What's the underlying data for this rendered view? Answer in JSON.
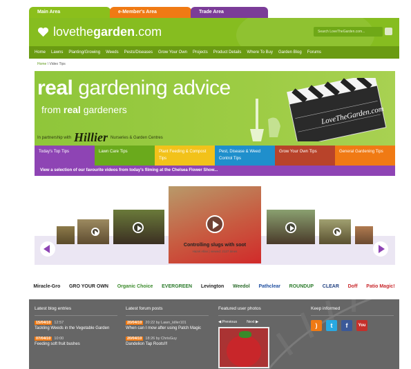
{
  "tabs": {
    "main": "Main Area",
    "member": "e-Member's Area",
    "trade": "Trade Area"
  },
  "logo": {
    "pre": "lovethe",
    "bold": "garden",
    "post": ".com"
  },
  "search": {
    "placeholder": "Search LoveTheGarden.com..."
  },
  "nav": [
    "Home",
    "Lawns",
    "Planting/Growing",
    "Weeds",
    "Pests/Diseases",
    "Grow Your Own",
    "Projects",
    "Product Details",
    "Where To Buy",
    "Garden Blog",
    "Forums"
  ],
  "breadcrumb": {
    "home": "Home",
    "sep": " \\ ",
    "current": "Video Tips"
  },
  "hero": {
    "line1_bold": "real",
    "line1_rest": " gardening advice",
    "line2_pre": "from ",
    "line2_bold": "real",
    "line2_post": " gardeners",
    "partner_pre": "In partnership with",
    "partner_brand": "Hillier",
    "partner_post": "Nurseries & Garden Centres",
    "clapper_text": "LoveTheGarden.com"
  },
  "tips": [
    {
      "label": "Today's Top Tips",
      "color": "#8e44b4"
    },
    {
      "label": "Lawn Care Tips",
      "color": "#6aaa1c"
    },
    {
      "label": "Plant Feeding & Compost Tips",
      "color": "#f2c21a"
    },
    {
      "label": "Pest, Disease & Weed Control Tips",
      "color": "#1f8fcc"
    },
    {
      "label": "Grow Your Own Tips",
      "color": "#b8432a"
    },
    {
      "label": "General Gardening Tips",
      "color": "#f07a14"
    }
  ],
  "tip_note": "View a selection of our favourite videos from today's filming at the Chelsea Flower Show...",
  "video": {
    "title": "Controlling slugs with soot",
    "meta": "Hazel Allan | viewed: 2127 times"
  },
  "brands": [
    "Miracle-Gro",
    "GRO YOUR OWN",
    "Organic Choice",
    "EVERGREEN",
    "Levington",
    "Weedol",
    "Pathclear",
    "ROUNDUP",
    "CLEAR",
    "Doff",
    "Patio Magic!"
  ],
  "footer": {
    "blog": {
      "heading": "Latest blog entries",
      "posts": [
        {
          "date": "15/04/10",
          "time": "12:57",
          "text": "Tackling Weeds in the Vegetable Garden"
        },
        {
          "date": "07/04/10",
          "time": "10:00",
          "text": "Feeding soft fruit bushes"
        }
      ]
    },
    "forum": {
      "heading": "Latest forum posts",
      "posts": [
        {
          "date": "20/04/10",
          "time": "20:22 by Lawn_killer101",
          "text": "When can I mow after using Patch Magic"
        },
        {
          "date": "20/04/10",
          "time": "18:26 by ChrisGuy",
          "text": "Dandelion Tap Roots!!!"
        }
      ]
    },
    "photos": {
      "heading": "Featured user photos",
      "prev": "Previous",
      "next": "Next"
    },
    "social": {
      "heading": "Keep informed",
      "icons": [
        "rss-icon",
        "twitter-icon",
        "facebook-icon",
        "youtube-icon"
      ]
    }
  }
}
